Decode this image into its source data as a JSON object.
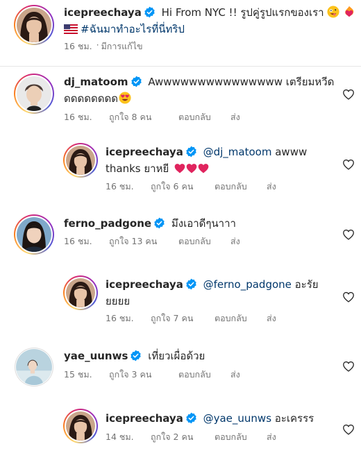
{
  "caption": {
    "username": "icepreechaya",
    "text_line1": "Hi From NYC !! รูปคู่รูปแรกของเรา",
    "text_line2": "#ฉันมาทำอะไรที่นี่ทริป",
    "time": "16 ชม.",
    "edited": "มีการแก้ไข"
  },
  "comments": [
    {
      "username": "dj_matoom",
      "text_line1": "Awwwwwwwwwwwwwww เตรียมหวีด",
      "text_line2": "ดดดดดดดด",
      "time": "16 ชม.",
      "likes": "ถูกใจ 8 คน",
      "reply": "ตอบกลับ",
      "send": "ส่ง",
      "reply_item": {
        "username": "icepreechaya",
        "mention": "@dj_matoom",
        "text_line1": "awww",
        "text_line2": "thanks ยาหยี",
        "time": "16 ชม.",
        "likes": "ถูกใจ 6 คน",
        "reply": "ตอบกลับ",
        "send": "ส่ง"
      }
    },
    {
      "username": "ferno_padgone",
      "text_line1": "มึงเอาดีๆนาาา",
      "time": "16 ชม.",
      "likes": "ถูกใจ 13 คน",
      "reply": "ตอบกลับ",
      "send": "ส่ง",
      "reply_item": {
        "username": "icepreechaya",
        "mention": "@ferno_padgone",
        "text_line1": "อะรัย",
        "text_line2": "ยยยย",
        "time": "16 ชม.",
        "likes": "ถูกใจ 7 คน",
        "reply": "ตอบกลับ",
        "send": "ส่ง"
      }
    },
    {
      "username": "yae_uunws",
      "text_line1": "เที่ยวเผื่อด้วย",
      "time": "15 ชม.",
      "likes": "ถูกใจ 3 คน",
      "reply": "ตอบกลับ",
      "send": "ส่ง",
      "reply_item": {
        "username": "icepreechaya",
        "mention": "@yae_uunws",
        "text_line1": "อะเครรร",
        "time": "14 ชม.",
        "likes": "ถูกใจ 2 คน",
        "reply": "ตอบกลับ",
        "send": "ส่ง"
      }
    }
  ],
  "icons": {
    "verified": "verified-badge-icon",
    "like": "heart-outline-icon",
    "flag": "us-flag-icon"
  },
  "colors": {
    "verified_blue": "#0095f6",
    "mention_blue": "#00376b",
    "meta_gray": "#737373",
    "heart_red": "#e0245e"
  }
}
